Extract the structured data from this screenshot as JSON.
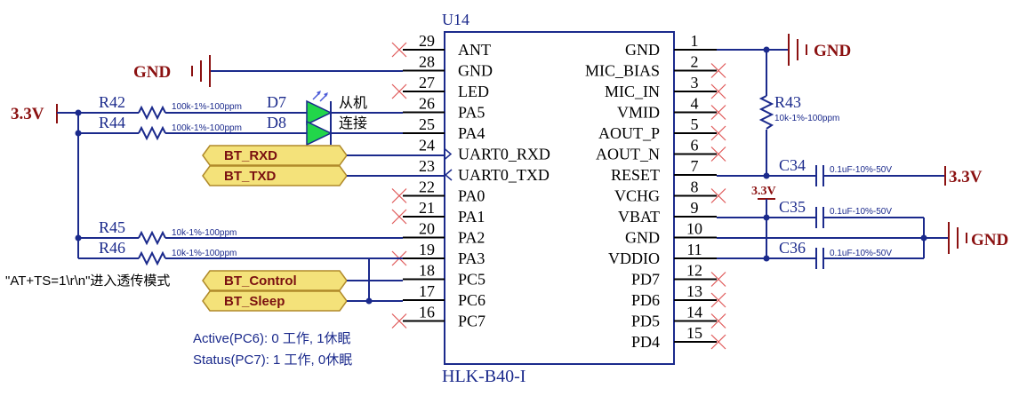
{
  "component": {
    "refdes": "U14",
    "part": "HLK-B40-I",
    "left_pins": [
      {
        "num": "29",
        "name": "ANT"
      },
      {
        "num": "28",
        "name": "GND"
      },
      {
        "num": "27",
        "name": "LED"
      },
      {
        "num": "26",
        "name": "PA5"
      },
      {
        "num": "25",
        "name": "PA4"
      },
      {
        "num": "24",
        "name": "UART0_RXD"
      },
      {
        "num": "23",
        "name": "UART0_TXD"
      },
      {
        "num": "22",
        "name": "PA0"
      },
      {
        "num": "21",
        "name": "PA1"
      },
      {
        "num": "20",
        "name": "PA2"
      },
      {
        "num": "19",
        "name": "PA3"
      },
      {
        "num": "18",
        "name": "PC5"
      },
      {
        "num": "17",
        "name": "PC6"
      },
      {
        "num": "16",
        "name": "PC7"
      }
    ],
    "right_pins": [
      {
        "num": "1",
        "name": "GND"
      },
      {
        "num": "2",
        "name": "MIC_BIAS"
      },
      {
        "num": "3",
        "name": "MIC_IN"
      },
      {
        "num": "4",
        "name": "VMID"
      },
      {
        "num": "5",
        "name": "AOUT_P"
      },
      {
        "num": "6",
        "name": "AOUT_N"
      },
      {
        "num": "7",
        "name": "RESET"
      },
      {
        "num": "8",
        "name": "VCHG"
      },
      {
        "num": "9",
        "name": "VBAT"
      },
      {
        "num": "10",
        "name": "GND"
      },
      {
        "num": "11",
        "name": "VDDIO"
      },
      {
        "num": "12",
        "name": "PD7"
      },
      {
        "num": "13",
        "name": "PD6"
      },
      {
        "num": "14",
        "name": "PD5"
      },
      {
        "num": "15",
        "name": "PD4"
      }
    ]
  },
  "power": {
    "gnd_left": "GND",
    "gnd_top": "GND",
    "gnd_right": "GND",
    "v33_left": "3.3V",
    "v33_right": "3.3V",
    "v33_small": "3.3V"
  },
  "resistors": {
    "r42": {
      "ref": "R42",
      "val": "100k-1%-100ppm"
    },
    "r44": {
      "ref": "R44",
      "val": "100k-1%-100ppm"
    },
    "r45": {
      "ref": "R45",
      "val": "10k-1%-100ppm"
    },
    "r46": {
      "ref": "R46",
      "val": "10k-1%-100ppm"
    },
    "r43": {
      "ref": "R43",
      "val": "10k-1%-100ppm"
    }
  },
  "leds": {
    "d7": {
      "ref": "D7",
      "label": "从机"
    },
    "d8": {
      "ref": "D8",
      "label": "连接"
    }
  },
  "caps": {
    "c34": {
      "ref": "C34",
      "val": "0.1uF-10%-50V"
    },
    "c35": {
      "ref": "C35",
      "val": "0.1uF-10%-50V"
    },
    "c36": {
      "ref": "C36",
      "val": "0.1uF-10%-50V"
    }
  },
  "net_labels": {
    "rxd": "BT_RXD",
    "txd": "BT_TXD",
    "control": "BT_Control",
    "sleep": "BT_Sleep"
  },
  "notes": {
    "at_cmd": "\"AT+TS=1\\r\\n\"进入透传模式",
    "active": "Active(PC6): 0 工作, 1休眠",
    "status": "Status(PC7): 1 工作, 0休眠"
  },
  "colors": {
    "wire": "#1b2a8c",
    "power": "#8b1111",
    "netlabel_fill": "#f4e27a",
    "led_fill": "#22d64a",
    "nc_mark": "#e05a5a"
  }
}
